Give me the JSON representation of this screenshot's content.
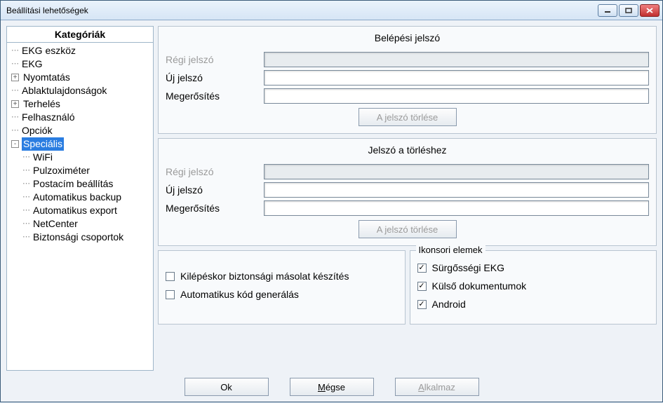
{
  "window": {
    "title": "Beállítási lehetőségek"
  },
  "tree": {
    "header": "Kategóriák",
    "items": [
      {
        "label": "EKG eszköz",
        "level": 1,
        "exp": null
      },
      {
        "label": "EKG",
        "level": 1,
        "exp": null
      },
      {
        "label": "Nyomtatás",
        "level": 1,
        "exp": "+"
      },
      {
        "label": "Ablaktulajdonságok",
        "level": 1,
        "exp": null
      },
      {
        "label": "Terhelés",
        "level": 1,
        "exp": "+"
      },
      {
        "label": "Felhasználó",
        "level": 1,
        "exp": null
      },
      {
        "label": "Opciók",
        "level": 1,
        "exp": null
      },
      {
        "label": "Speciális",
        "level": 1,
        "exp": "-",
        "selected": true
      },
      {
        "label": "WiFi",
        "level": 2,
        "exp": null
      },
      {
        "label": "Pulzoximéter",
        "level": 2,
        "exp": null
      },
      {
        "label": "Postacím beállítás",
        "level": 2,
        "exp": null
      },
      {
        "label": "Automatikus backup",
        "level": 2,
        "exp": null
      },
      {
        "label": "Automatikus export",
        "level": 2,
        "exp": null
      },
      {
        "label": "NetCenter",
        "level": 2,
        "exp": null
      },
      {
        "label": "Biztonsági csoportok",
        "level": 2,
        "exp": null
      }
    ]
  },
  "group1": {
    "title": "Belépési jelszó",
    "old_label": "Régi jelszó",
    "new_label": "Új jelszó",
    "conf_label": "Megerősítés",
    "clear_btn": "A jelszó törlése"
  },
  "group2": {
    "title": "Jelszó a törléshez",
    "old_label": "Régi jelszó",
    "new_label": "Új jelszó",
    "conf_label": "Megerősítés",
    "clear_btn": "A jelszó törlése"
  },
  "options": {
    "backup_on_exit": "Kilépéskor biztonsági másolat készítés",
    "auto_code_gen": "Automatikus kód generálás"
  },
  "iconbar": {
    "legend": "Ikonsori elemek",
    "emergency": "Sürgősségi EKG",
    "external_docs": "Külső dokumentumok",
    "android": "Android"
  },
  "buttons": {
    "ok": "Ok",
    "cancel_prefix": "M",
    "cancel_rest": "égse",
    "apply_prefix": "A",
    "apply_rest": "lkalmaz"
  }
}
